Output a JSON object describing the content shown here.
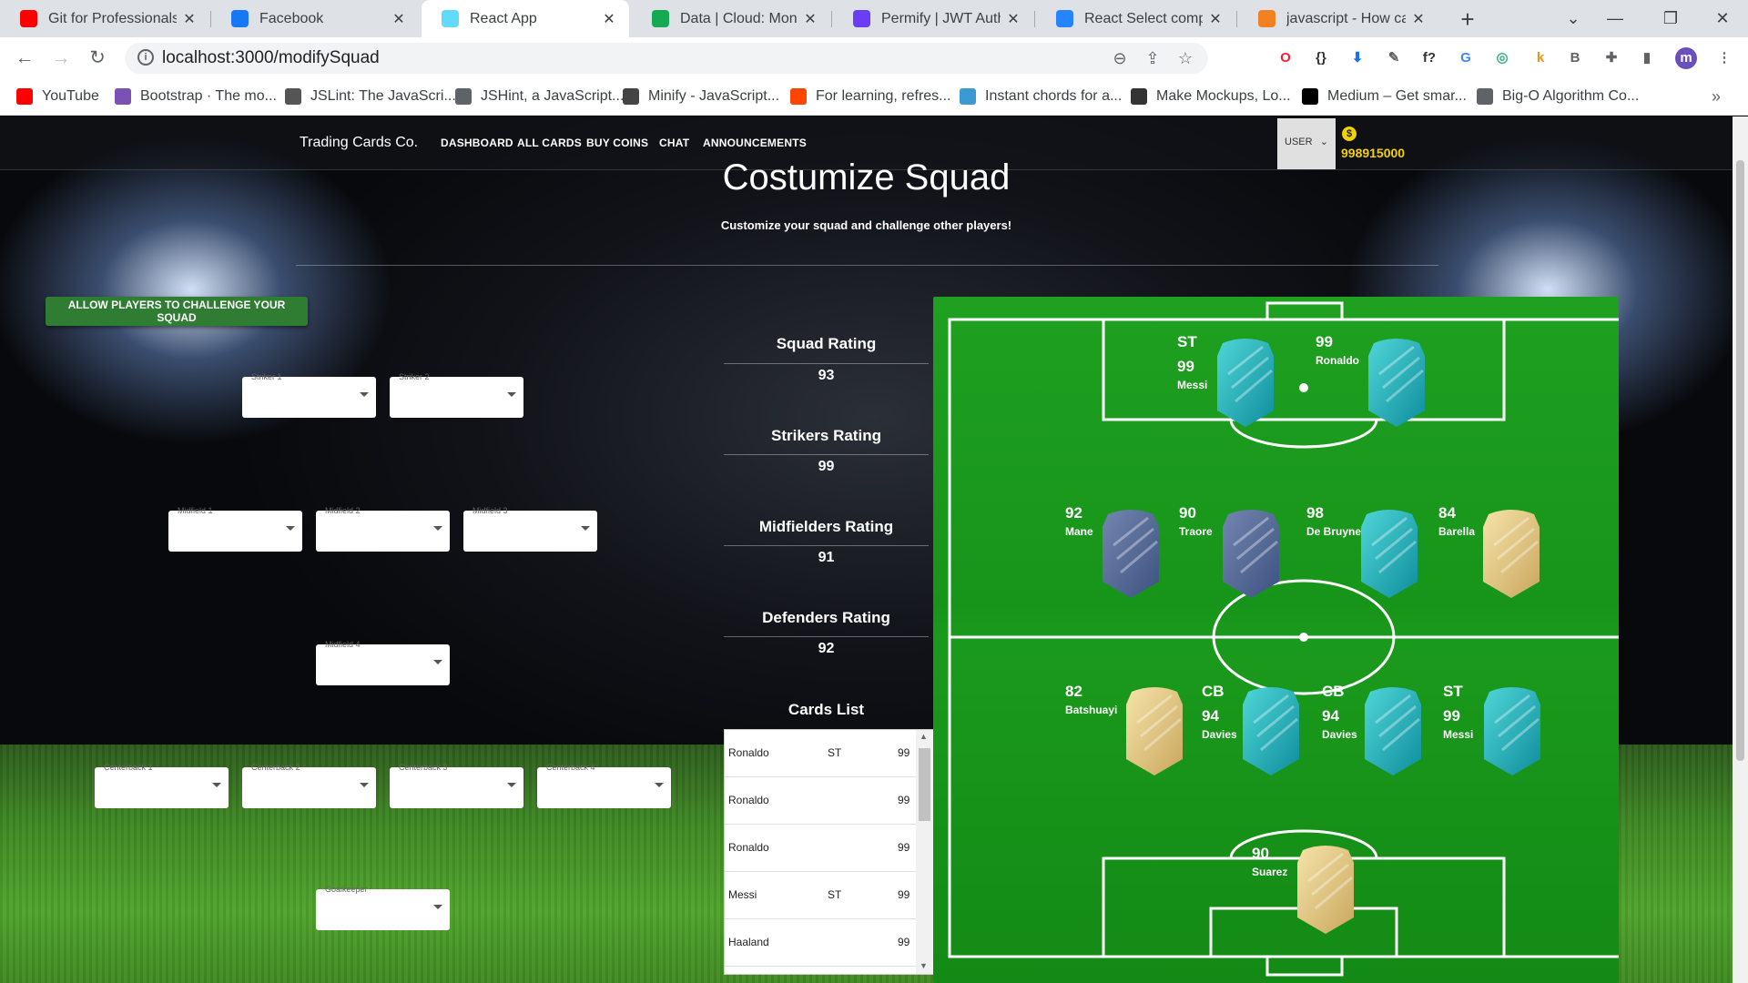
{
  "browser": {
    "tabs": [
      {
        "title": "Git for Professionals T",
        "favicon": "youtube-icon",
        "color": "#ff0000"
      },
      {
        "title": "Facebook",
        "favicon": "facebook-icon",
        "color": "#1877f2"
      },
      {
        "title": "React App",
        "favicon": "react-icon",
        "color": "#61dafb"
      },
      {
        "title": "Data | Cloud: MongoD",
        "favicon": "mongodb-icon",
        "color": "#13aa52"
      },
      {
        "title": "Permify | JWT Authent",
        "favicon": "permify-icon",
        "color": "#6b3df5"
      },
      {
        "title": "React Select compone",
        "favicon": "react-select-icon",
        "color": "#2684ff"
      },
      {
        "title": "javascript - How can I",
        "favicon": "stackoverflow-icon",
        "color": "#f48024"
      }
    ],
    "url": "localhost:3000/modifySquad",
    "bookmarks": [
      {
        "label": "YouTube",
        "icon": "youtube-icon",
        "color": "#ff0000"
      },
      {
        "label": "Bootstrap · The mo...",
        "icon": "bootstrap-icon",
        "color": "#7952b3"
      },
      {
        "label": "JSLint: The JavaScri...",
        "icon": "jslint-icon",
        "color": "#555555"
      },
      {
        "label": "JSHint, a JavaScript...",
        "icon": "globe-icon",
        "color": "#5f6368"
      },
      {
        "label": "Minify - JavaScript...",
        "icon": "minify-icon",
        "color": "#444444"
      },
      {
        "label": "For learning, refres...",
        "icon": "reddit-icon",
        "color": "#ff4500"
      },
      {
        "label": "Instant chords for a...",
        "icon": "chords-icon",
        "color": "#3b9bd1"
      },
      {
        "label": "Make Mockups, Lo...",
        "icon": "pencil-icon",
        "color": "#333333"
      },
      {
        "label": "Medium – Get smar...",
        "icon": "medium-icon",
        "color": "#000000"
      },
      {
        "label": "Big-O Algorithm Co...",
        "icon": "globe-icon",
        "color": "#5f6368"
      }
    ],
    "extensions": [
      {
        "name": "opera-icon",
        "glyph": "O",
        "color": "#ff1b2d"
      },
      {
        "name": "json-icon",
        "glyph": "{}",
        "color": "#333333"
      },
      {
        "name": "download-icon",
        "glyph": "⬇",
        "color": "#1a73e8"
      },
      {
        "name": "eyedropper-icon",
        "glyph": "✎",
        "color": "#5f6368"
      },
      {
        "name": "function-icon",
        "glyph": "f?",
        "color": "#333333"
      },
      {
        "name": "translate-icon",
        "glyph": "G",
        "color": "#4285f4"
      },
      {
        "name": "color-icon",
        "glyph": "◎",
        "color": "#35b18a"
      },
      {
        "name": "k-icon",
        "glyph": "k",
        "color": "#f29111"
      },
      {
        "name": "b-icon",
        "glyph": "B",
        "color": "#5f6368"
      },
      {
        "name": "puzzle-icon",
        "glyph": "✚",
        "color": "#5f6368"
      },
      {
        "name": "sidepanel-icon",
        "glyph": "▮",
        "color": "#5f6368"
      }
    ]
  },
  "app": {
    "brand": "Trading Cards Co.",
    "nav": [
      "DASHBOARD",
      "ALL CARDS",
      "BUY COINS",
      "CHAT",
      "ANNOUNCEMENTS"
    ],
    "user_select": "USER",
    "coins": "998915000",
    "title": "Costumize Squad",
    "subtitle": "Customize your squad and challenge other players!",
    "challenge_button": "ALLOW PLAYERS TO CHALLENGE YOUR SQUAD"
  },
  "selects": [
    {
      "label": "Striker 1"
    },
    {
      "label": "Striker 2"
    },
    {
      "label": "Midfield 1"
    },
    {
      "label": "Midfield 2"
    },
    {
      "label": "Midfield 3"
    },
    {
      "label": "Midfield 4"
    },
    {
      "label": "Centerback 1"
    },
    {
      "label": "Centerback 2"
    },
    {
      "label": "Centerback 3"
    },
    {
      "label": "Centerback 4"
    },
    {
      "label": "Goalkeeper"
    }
  ],
  "ratings": [
    {
      "title": "Squad Rating",
      "value": "93"
    },
    {
      "title": "Strikers Rating",
      "value": "99"
    },
    {
      "title": "Midfielders Rating",
      "value": "91"
    },
    {
      "title": "Defenders Rating",
      "value": "92"
    }
  ],
  "cards_list": {
    "title": "Cards List",
    "rows": [
      {
        "name": "Ronaldo",
        "position": "ST",
        "rating": "99"
      },
      {
        "name": "Ronaldo",
        "position": "",
        "rating": "99"
      },
      {
        "name": "Ronaldo",
        "position": "",
        "rating": "99"
      },
      {
        "name": "Messi",
        "position": "ST",
        "rating": "99"
      },
      {
        "name": "Haaland",
        "position": "",
        "rating": "99"
      }
    ]
  },
  "pitch": {
    "players": [
      {
        "pos": "ST",
        "rating": "99",
        "name": "Messi",
        "card": "teal"
      },
      {
        "pos": "",
        "rating": "99",
        "name": "Ronaldo",
        "card": "teal"
      },
      {
        "pos": "",
        "rating": "92",
        "name": "Mane",
        "card": "blue"
      },
      {
        "pos": "",
        "rating": "90",
        "name": "Traore",
        "card": "blue"
      },
      {
        "pos": "",
        "rating": "98",
        "name": "De Bruyne",
        "card": "teal"
      },
      {
        "pos": "",
        "rating": "84",
        "name": "Barella",
        "card": "gold"
      },
      {
        "pos": "",
        "rating": "82",
        "name": "Batshuayi",
        "card": "gold"
      },
      {
        "pos": "CB",
        "rating": "94",
        "name": "Davies",
        "card": "teal"
      },
      {
        "pos": "CB",
        "rating": "94",
        "name": "Davies",
        "card": "teal"
      },
      {
        "pos": "ST",
        "rating": "99",
        "name": "Messi",
        "card": "teal"
      },
      {
        "pos": "",
        "rating": "90",
        "name": "Suarez",
        "card": "gold"
      }
    ]
  },
  "colors": {
    "accent_green": "#2e7d32",
    "coin_yellow": "#f3d000",
    "card_teal": "#1fb5c4",
    "card_blue": "#5a6f9e",
    "card_gold": "#e8cf8f"
  }
}
